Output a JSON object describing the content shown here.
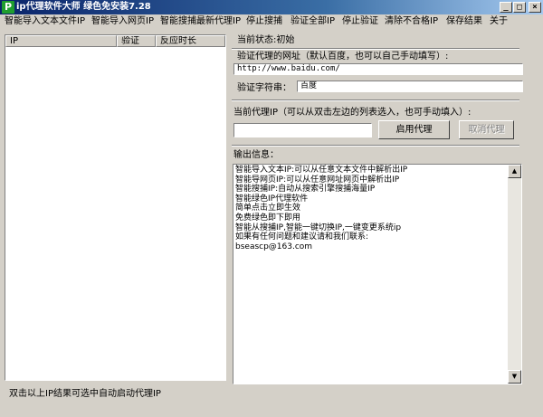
{
  "window": {
    "icon_letter": "P",
    "title": "ip代理软件大师  绿色免安装7.28",
    "controls": {
      "minimize": "_",
      "maximize": "□",
      "close": "×"
    }
  },
  "menu": {
    "items": [
      "智能导入文本文件IP",
      "智能导入网页IP",
      "智能搜捕最新代理IP",
      "停止搜捕",
      "验证全部IP",
      "停止验证",
      "清除不合格IP",
      "保存结果",
      "关于"
    ]
  },
  "list": {
    "columns": [
      "IP",
      "验证",
      "反应时长"
    ],
    "rows": []
  },
  "left_status": "双击以上IP结果可选中自动启动代理IP",
  "right": {
    "state_label": "当前状态:初始",
    "verify_url_label": "验证代理的网址（默认百度，也可以自己手动填写）:",
    "verify_url_value": "http://www.baidu.com/",
    "verify_string_label": "验证字符串：",
    "verify_string_value": "百度",
    "current_proxy_label": "当前代理IP（可以从双击左边的列表选入，也可手动填入）:",
    "current_proxy_value": "",
    "enable_proxy_button": "启用代理",
    "cancel_proxy_button": "取消代理",
    "output_label": "输出信息：",
    "output_lines": [
      "智能导入文本IP:可以从任意文本文件中解析出IP",
      "智能导网页IP:可以从任意网址网页中解析出IP",
      "智能搜捕IP:自动从搜索引擎搜捕海量IP",
      "智能绿色IP代理软件",
      "简单点击立即生效",
      "免费绿色即下即用",
      "智能从搜捕IP,智能一键切换IP,一键变更系统ip",
      "如果有任何问题和建议请和我们联系:",
      "bseascp@163.com"
    ]
  },
  "colors": {
    "face": "#d4d0c8",
    "title_start": "#0a246a",
    "title_end": "#a6caf0",
    "icon_green": "#1f9e2f"
  }
}
